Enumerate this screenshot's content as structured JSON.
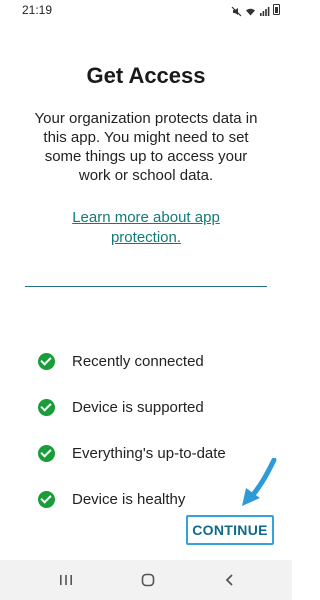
{
  "status_bar": {
    "time": "21:19"
  },
  "title": "Get Access",
  "description": "Your organization protects data in this app. You might need to set some things up to access your work or school data.",
  "learn_more_link": "Learn more about app protection.",
  "checks": [
    {
      "label": "Recently connected",
      "icon": "check-circle-icon"
    },
    {
      "label": "Device is supported",
      "icon": "check-circle-icon"
    },
    {
      "label": "Everything's up-to-date",
      "icon": "check-circle-icon"
    },
    {
      "label": "Device is healthy",
      "icon": "check-circle-icon"
    }
  ],
  "continue_button": "CONTINUE",
  "colors": {
    "check_green": "#1a9c3a",
    "link_teal": "#137a7a",
    "button_highlight": "#34a3d8",
    "arrow_blue": "#2f9bd6"
  }
}
